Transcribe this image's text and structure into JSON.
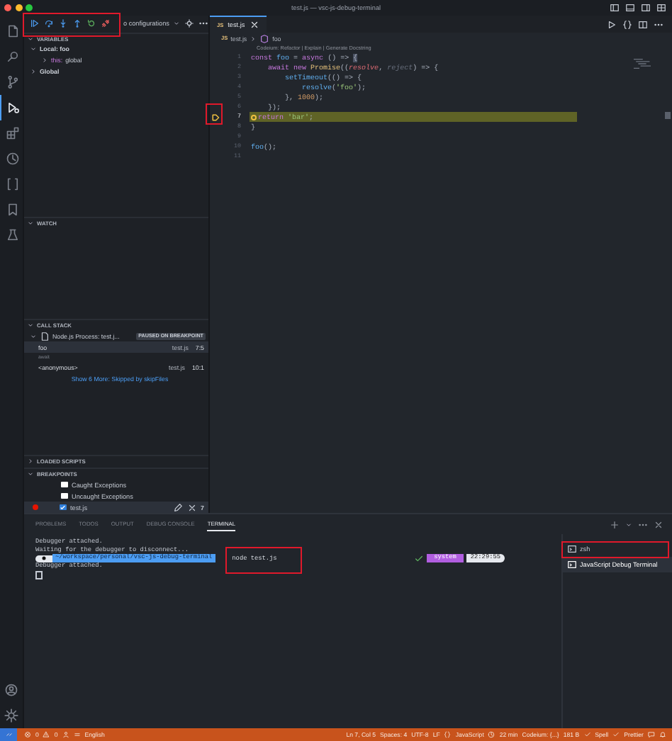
{
  "window": {
    "title": "test.js — vsc-js-debug-terminal"
  },
  "activity_bar": {
    "items": [
      {
        "selected": false
      },
      {
        "selected": false
      },
      {
        "selected": false
      },
      {
        "selected": true
      },
      {
        "selected": false
      },
      {
        "selected": false
      },
      {
        "selected": false
      },
      {
        "selected": false
      },
      {
        "selected": false
      }
    ]
  },
  "debug_toolbar": {
    "configuration": "o configurations"
  },
  "sidebar": {
    "sections": [
      {
        "kind": "variables",
        "title": "VARIABLES",
        "expanded": true,
        "items": [
          {
            "label": "Local: foo",
            "expanded": true,
            "children": [
              {
                "name": "this:",
                "value": "global",
                "expanded": false
              }
            ]
          },
          {
            "label": "Global",
            "expanded": false
          }
        ]
      },
      {
        "kind": "watch",
        "title": "WATCH",
        "expanded": true
      },
      {
        "kind": "call_stack",
        "title": "CALL STACK",
        "expanded": true,
        "session": {
          "label": "Node.js Process: test.j...",
          "badge": "PAUSED ON BREAKPOINT",
          "expanded": true
        },
        "frames": [
          {
            "kind": "frame",
            "name": "foo",
            "file": "test.js",
            "position": "7:5",
            "selected": true
          },
          {
            "kind": "label",
            "name": "await",
            "selected": false
          },
          {
            "kind": "frame",
            "name": "<anonymous>",
            "file": "test.js",
            "position": "10:1",
            "selected": false
          },
          {
            "kind": "link",
            "name": "Show 6 More: Skipped by skipFiles",
            "selected": false
          }
        ]
      },
      {
        "kind": "loaded_scripts",
        "title": "LOADED SCRIPTS",
        "expanded": false
      },
      {
        "kind": "breakpoints",
        "title": "BREAKPOINTS",
        "expanded": true,
        "items": [
          {
            "kind": "exception",
            "label": "Caught Exceptions",
            "checked": false
          },
          {
            "kind": "exception",
            "label": "Uncaught Exceptions",
            "checked": false
          },
          {
            "kind": "file",
            "label": "test.js",
            "checked": true,
            "line": "7"
          }
        ]
      }
    ]
  },
  "editor": {
    "tabs": [
      {
        "badge": "JS",
        "label": "test.js",
        "selected": true
      }
    ],
    "breadcrumb": {
      "badge": "JS",
      "file": "test.js",
      "symbol": "foo"
    },
    "codelens": "Codeium: Refactor | Explain | Generate Docstring",
    "lines": [
      {
        "number": "1",
        "paused": false,
        "tokens": [
          {
            "kind": "kw",
            "text": "const "
          },
          {
            "kind": "fn",
            "text": "foo"
          },
          {
            "kind": "op",
            "text": " = "
          },
          {
            "kind": "kw",
            "text": "async"
          },
          {
            "kind": "op",
            "text": " () => "
          },
          {
            "kind": "cursor",
            "text": "{"
          }
        ]
      },
      {
        "number": "2",
        "paused": false,
        "tokens": [
          {
            "kind": "kw",
            "text": "    await new "
          },
          {
            "kind": "cls",
            "text": "Promise"
          },
          {
            "kind": "op",
            "text": "(("
          },
          {
            "kind": "param",
            "text": "resolve"
          },
          {
            "kind": "op",
            "text": ", "
          },
          {
            "kind": "unused",
            "text": "reject"
          },
          {
            "kind": "op",
            "text": ") => {"
          }
        ]
      },
      {
        "number": "3",
        "paused": false,
        "tokens": [
          {
            "kind": "fn",
            "text": "        setTimeout"
          },
          {
            "kind": "op",
            "text": "(() => {"
          }
        ]
      },
      {
        "number": "4",
        "paused": false,
        "tokens": [
          {
            "kind": "fn",
            "text": "            resolve"
          },
          {
            "kind": "op",
            "text": "("
          },
          {
            "kind": "str",
            "text": "'foo'"
          },
          {
            "kind": "op",
            "text": ");"
          }
        ]
      },
      {
        "number": "5",
        "paused": false,
        "tokens": [
          {
            "kind": "op",
            "text": "        }, "
          },
          {
            "kind": "num",
            "text": "1000"
          },
          {
            "kind": "op",
            "text": ");"
          }
        ]
      },
      {
        "number": "6",
        "paused": false,
        "tokens": [
          {
            "kind": "op",
            "text": "    });"
          }
        ]
      },
      {
        "number": "7",
        "paused": true,
        "tokens": [
          {
            "kind": "kw",
            "text": "return "
          },
          {
            "kind": "str",
            "text": "'bar'"
          },
          {
            "kind": "op",
            "text": ";"
          }
        ]
      },
      {
        "number": "8",
        "paused": false,
        "tokens": [
          {
            "kind": "op",
            "text": "}"
          }
        ]
      },
      {
        "number": "9",
        "paused": false
      },
      {
        "number": "10",
        "paused": false,
        "tokens": [
          {
            "kind": "fn",
            "text": "foo"
          },
          {
            "kind": "op",
            "text": "();"
          }
        ]
      },
      {
        "number": "11",
        "paused": false
      }
    ]
  },
  "panel": {
    "tabs": [
      {
        "label": "PROBLEMS",
        "selected": false
      },
      {
        "label": "TODOS",
        "selected": false
      },
      {
        "label": "OUTPUT",
        "selected": false
      },
      {
        "label": "DEBUG CONSOLE",
        "selected": false
      },
      {
        "label": "TERMINAL",
        "selected": true
      }
    ],
    "terminal": {
      "lines": [
        {
          "kind": "text",
          "text": "Debugger attached."
        },
        {
          "kind": "text",
          "text": "Waiting for the debugger to disconnect..."
        },
        {
          "kind": "prompt",
          "path": "~/workspace/personal/vsc-js-debug-terminal",
          "command": "node test.js",
          "context": "system",
          "time": "22:29:55"
        },
        {
          "kind": "text",
          "text": "Debugger attached."
        },
        {
          "kind": "cursor"
        }
      ]
    },
    "sessions": [
      {
        "label": "zsh",
        "selected": false
      },
      {
        "label": "JavaScript Debug Terminal",
        "selected": true
      }
    ]
  },
  "status_bar": {
    "errors": "0",
    "warnings": "0",
    "spell_language": "English",
    "right": [
      {
        "kind": "plain",
        "text": "Ln 7, Col 5"
      },
      {
        "kind": "plain",
        "text": "Spaces: 4"
      },
      {
        "kind": "plain",
        "text": "UTF-8"
      },
      {
        "kind": "plain",
        "text": "LF"
      },
      {
        "kind": "braces",
        "text": "JavaScript"
      },
      {
        "kind": "clock",
        "text": "22 min"
      },
      {
        "kind": "plain",
        "text": "Codeium: {...}"
      },
      {
        "kind": "plain",
        "text": "181 B"
      },
      {
        "kind": "check",
        "text": "Spell"
      },
      {
        "kind": "check",
        "text": "Prettier"
      }
    ]
  }
}
